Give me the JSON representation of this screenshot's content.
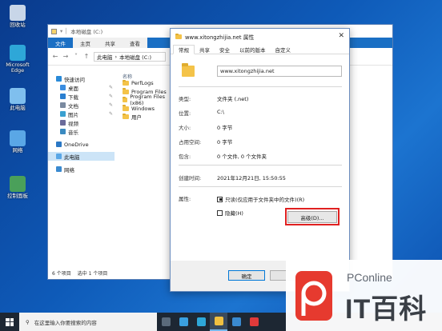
{
  "desktop": {
    "icons": [
      {
        "label": "回收站",
        "color": "#c8d6e8"
      },
      {
        "label": "Microsoft Edge",
        "color": "#2ea7d8"
      },
      {
        "label": "此电脑",
        "color": "#7fbfee"
      },
      {
        "label": "网络",
        "color": "#5aa7e6"
      },
      {
        "label": "控制面板",
        "color": "#4aa05a"
      }
    ]
  },
  "explorer": {
    "title": "本地磁盘 (C:)",
    "ribbon_tabs": [
      "文件",
      "主页",
      "共享",
      "查看"
    ],
    "address_parts": [
      "此电脑",
      "本地磁盘 (C:)"
    ],
    "nav": [
      {
        "label": "快速访问",
        "child": false,
        "pinned": false,
        "color": "#2a8ad8"
      },
      {
        "label": "桌面",
        "child": true,
        "pinned": true,
        "color": "#3b8de0"
      },
      {
        "label": "下载",
        "child": true,
        "pinned": true,
        "color": "#2a7fd0"
      },
      {
        "label": "文档",
        "child": true,
        "pinned": true,
        "color": "#7a8aa0"
      },
      {
        "label": "图片",
        "child": true,
        "pinned": true,
        "color": "#3aa0d0"
      },
      {
        "label": "视频",
        "child": true,
        "pinned": false,
        "color": "#6a6a9a"
      },
      {
        "label": "音乐",
        "child": true,
        "pinned": false,
        "color": "#3a8ac0"
      },
      {
        "label": "OneDrive",
        "child": false,
        "pinned": false,
        "color": "#2b78c5"
      },
      {
        "label": "此电脑",
        "child": false,
        "pinned": false,
        "color": "#5aa7e6"
      },
      {
        "label": "网络",
        "child": false,
        "pinned": false,
        "color": "#3a8ad0"
      }
    ],
    "column_header": "名称",
    "files": [
      "PerfLogs",
      "Program Files",
      "Program Files (x86)",
      "Windows",
      "用户"
    ],
    "status": {
      "items": "6 个项目",
      "selected": "选中 1 个项目"
    }
  },
  "dialog": {
    "title": "www.xitongzhijia.net 属性",
    "tabs": [
      "常规",
      "共享",
      "安全",
      "以前的版本",
      "自定义"
    ],
    "active_tab": "常规",
    "name": "www.xitongzhijia.net",
    "rows": {
      "type": {
        "k": "类型:",
        "v": "文件夹 (.net)"
      },
      "location": {
        "k": "位置:",
        "v": "C:\\"
      },
      "size": {
        "k": "大小:",
        "v": "0 字节"
      },
      "size_on_disk": {
        "k": "占用空间:",
        "v": "0 字节"
      },
      "contains": {
        "k": "包含:",
        "v": "0 个文件, 0 个文件夹"
      },
      "created": {
        "k": "创建时间:",
        "v": "2021年12月21日, 15:50:55"
      },
      "attributes": {
        "k": "属性:",
        "v": ""
      }
    },
    "readonly_label": "只读(仅应用于文件夹中的文件)(R)",
    "hidden_label": "隐藏(H)",
    "advanced_label": "高级(D)...",
    "ok_label": "确定",
    "highlight_color": "#e02020"
  },
  "taskbar": {
    "search_placeholder": "在这里输入你要搜索的内容",
    "apps": [
      {
        "color": "#5a6a7a",
        "active": false
      },
      {
        "color": "#3aa0e0",
        "active": false
      },
      {
        "color": "#2ea7d8",
        "active": false
      },
      {
        "color": "#f0c040",
        "active": true
      },
      {
        "color": "#3a8ad0",
        "active": false
      },
      {
        "color": "#e03a3a",
        "active": false
      }
    ]
  },
  "watermark": {
    "small": "PConline",
    "big": "IT百科"
  }
}
